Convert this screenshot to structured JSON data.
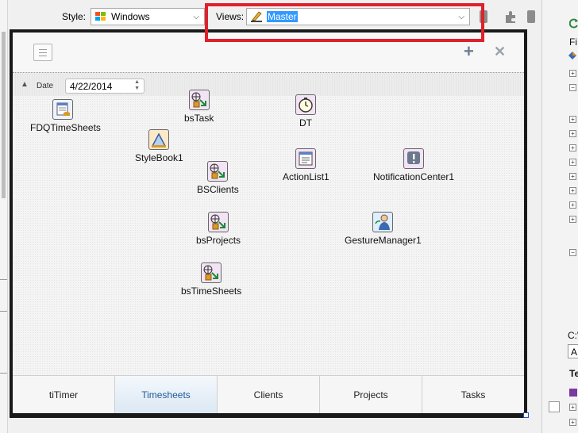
{
  "toolbar": {
    "style_label": "Style:",
    "style_value": "Windows",
    "views_label": "Views:",
    "views_value": "Master"
  },
  "form": {
    "date_label": "Date",
    "date_value": "4/22/2014"
  },
  "components": [
    {
      "name": "FDQTimeSheets",
      "icon": "fdq-icon"
    },
    {
      "name": "bsTask",
      "icon": "binding-source-icon"
    },
    {
      "name": "DT",
      "icon": "timer-icon"
    },
    {
      "name": "StyleBook1",
      "icon": "stylebook-icon"
    },
    {
      "name": "BSClients",
      "icon": "binding-source-icon"
    },
    {
      "name": "ActionList1",
      "icon": "actionlist-icon"
    },
    {
      "name": "NotificationCenter1",
      "icon": "notification-icon"
    },
    {
      "name": "bsProjects",
      "icon": "binding-source-icon"
    },
    {
      "name": "GestureManager1",
      "icon": "gesture-icon"
    },
    {
      "name": "bsTimeSheets",
      "icon": "binding-source-icon"
    }
  ],
  "tabs": [
    {
      "label": "tiTimer",
      "active": false
    },
    {
      "label": "Timesheets",
      "active": true
    },
    {
      "label": "Clients",
      "active": false
    },
    {
      "label": "Projects",
      "active": false
    },
    {
      "label": "Tasks",
      "active": false
    }
  ],
  "right_panel": {
    "label_fi": "Fi",
    "label_c": "C:\\",
    "label_a": "A",
    "label_te": "Te"
  },
  "colors": {
    "highlight": "#e0202a",
    "selection": "#3399ff",
    "active_tab_text": "#1f5a96"
  }
}
